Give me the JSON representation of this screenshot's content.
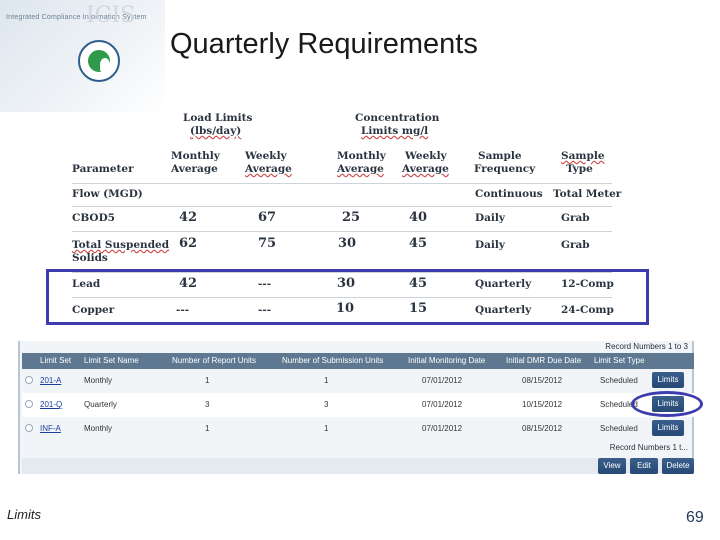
{
  "header": {
    "subtitle": "Integrated Compliance Information System",
    "logo_text": "ICIS",
    "title": "Quarterly Requirements"
  },
  "limits_table": {
    "group_headers": {
      "load": [
        "Load Limits",
        "(lbs/day)"
      ],
      "conc": [
        "Concentration",
        "Limits mg/l"
      ]
    },
    "columns": {
      "parameter": "Parameter",
      "load_monthly": [
        "Monthly",
        "Average"
      ],
      "load_weekly": [
        "Weekly",
        "Average"
      ],
      "conc_monthly": [
        "Monthly",
        "Average"
      ],
      "conc_weekly": [
        "Weekly",
        "Average"
      ],
      "freq": [
        "Sample",
        "Frequency"
      ],
      "type": [
        "Sample",
        "Type"
      ]
    },
    "rows": [
      {
        "param": "Flow (MGD)",
        "param2": "",
        "lm": "",
        "lw": "",
        "cm": "",
        "cw": "",
        "freq": "Continuous",
        "type": "Total Meter"
      },
      {
        "param": "CBOD5",
        "param2": "",
        "lm": "42",
        "lw": "67",
        "cm": "25",
        "cw": "40",
        "freq": "Daily",
        "type": "Grab"
      },
      {
        "param": "Total Suspended",
        "param2": "Solids",
        "lm": "62",
        "lw": "75",
        "cm": "30",
        "cw": "45",
        "freq": "Daily",
        "type": "Grab"
      },
      {
        "param": "Lead",
        "param2": "",
        "lm": "42",
        "lw": "---",
        "cm": "30",
        "cw": "45",
        "freq": "Quarterly",
        "type": "12-Comp"
      },
      {
        "param": "Copper",
        "param2": "",
        "lm": "---",
        "lw": "---",
        "cm": "10",
        "cw": "15",
        "freq": "Quarterly",
        "type": "24-Comp"
      }
    ]
  },
  "limit_sets": {
    "record_numbers_top": "Record Numbers 1 to 3",
    "record_numbers_bottom": "Record Numbers 1 t...",
    "headers": [
      "Limit Set",
      "Limit Set Name",
      "Number of Report Units",
      "Number of Submission Units",
      "Initial Monitoring Date",
      "Initial DMR Due Date",
      "Limit Set Type"
    ],
    "rows": [
      {
        "set": "201-A",
        "name": "Monthly",
        "report_units": "1",
        "submission_units": "1",
        "monitoring_date": "07/01/2012",
        "due_date": "08/15/2012",
        "type": "Scheduled",
        "button": "Limits"
      },
      {
        "set": "201-Q",
        "name": "Quarterly",
        "report_units": "3",
        "submission_units": "3",
        "monitoring_date": "07/01/2012",
        "due_date": "10/15/2012",
        "type": "Scheduled",
        "button": "Limits"
      },
      {
        "set": "INF-A",
        "name": "Monthly",
        "report_units": "1",
        "submission_units": "1",
        "monitoring_date": "07/01/2012",
        "due_date": "08/15/2012",
        "type": "Scheduled",
        "button": "Limits"
      }
    ],
    "actions": {
      "view": "View",
      "edit": "Edit",
      "delete": "Delete"
    }
  },
  "footer": {
    "left": "Limits",
    "page_number": "69"
  },
  "colors": {
    "highlight": "#3c3cae",
    "header_bar": "#5e7891",
    "button": "#264a74"
  }
}
